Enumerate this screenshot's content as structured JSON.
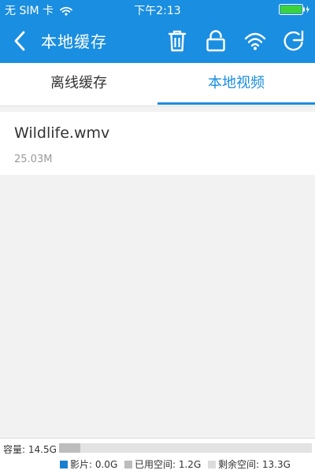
{
  "status_bar": {
    "carrier": "无 SIM 卡",
    "time": "下午2:13"
  },
  "navbar": {
    "title": "本地缓存",
    "icons": [
      "back-arrow-icon",
      "trash-icon",
      "lock-icon",
      "wifi-icon",
      "refresh-icon"
    ]
  },
  "tabs": [
    {
      "label": "离线缓存",
      "active": false
    },
    {
      "label": "本地视频",
      "active": true
    }
  ],
  "videos": [
    {
      "name": "Wildlife.wmv",
      "size": "25.03M"
    }
  ],
  "storage": {
    "capacity_label": "容量: 14.5G",
    "used_fraction": 0.083,
    "legend": [
      {
        "label": "影片: 0.0G",
        "color": "#1a7fd0"
      },
      {
        "label": "已用空间: 1.2G",
        "color": "#bdbdbd"
      },
      {
        "label": "剩余空间: 13.3G",
        "color": "#dcdcdc"
      }
    ]
  },
  "colors": {
    "accent": "#1a8ee0"
  }
}
